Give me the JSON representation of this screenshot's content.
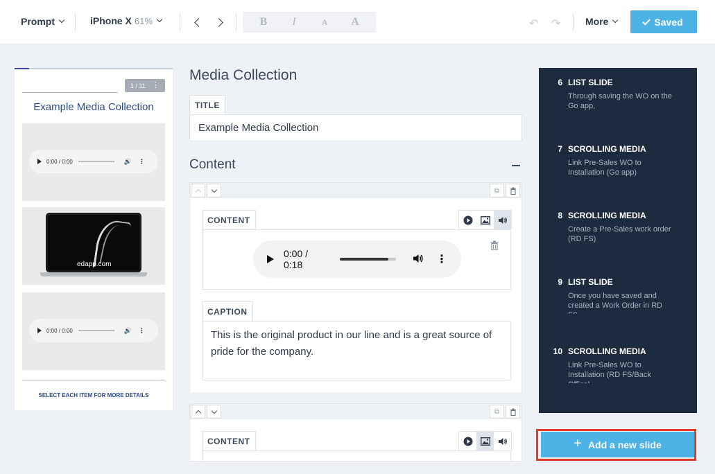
{
  "toolbar": {
    "prompt_label": "Prompt",
    "device_label": "iPhone X",
    "zoom": "61%",
    "format_buttons": [
      "B",
      "I",
      "A",
      "A"
    ],
    "undo_icon": "↶",
    "redo_icon": "↷",
    "more_label": "More",
    "saved_label": "Saved"
  },
  "preview": {
    "page_indicator": "1 / 11",
    "title": "Example Media Collection",
    "audio_time": "0:00 / 0:00",
    "audio_time_2": "0:00 / 0:00",
    "image_brand": "edapp.com",
    "footer": "SELECT EACH ITEM FOR MORE DETAILS"
  },
  "editor": {
    "heading": "Media Collection",
    "title_label": "TITLE",
    "title_value": "Example Media Collection",
    "content_heading": "Content",
    "items": [
      {
        "content_label": "CONTENT",
        "audio_time": "0:00 / 0:18",
        "caption_label": "CAPTION",
        "caption": "This is the original product in our line and is a great source of pride for the company."
      },
      {
        "content_label": "CONTENT"
      }
    ]
  },
  "slides": [
    {
      "num": "6",
      "type": "LIST SLIDE",
      "desc": "Through saving the WO on the Go app,"
    },
    {
      "num": "7",
      "type": "SCROLLING MEDIA",
      "desc": "Link Pre-Sales WO to Installation (Go app)"
    },
    {
      "num": "8",
      "type": "SCROLLING MEDIA",
      "desc": "Create a Pre-Sales work order (RD FS)"
    },
    {
      "num": "9",
      "type": "LIST SLIDE",
      "desc": "Once you have saved and created a Work Order in RD FS"
    },
    {
      "num": "10",
      "type": "SCROLLING MEDIA",
      "desc": "Link Pre-Sales WO to Installation (RD FS/Back Office)"
    }
  ],
  "add_slide_label": "Add a new slide",
  "colors": {
    "accent": "#4db3e6",
    "slide_panel": "#1e2b3e",
    "highlight": "#e53a2a",
    "preview_text": "#2d4a8a"
  }
}
